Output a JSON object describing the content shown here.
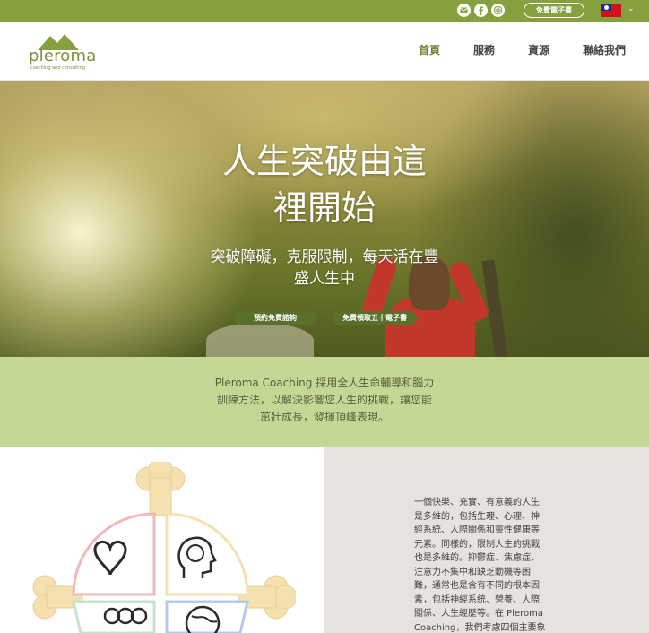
{
  "topbar": {
    "social_icons": [
      "email-icon",
      "facebook-icon",
      "instagram-icon"
    ],
    "ebook_button": "免費電子書",
    "language_flag": "taiwan-flag-icon",
    "bar_color": "#86a040"
  },
  "header": {
    "logo_text": "pleroma",
    "logo_tagline": "coaching and consulting",
    "nav": [
      "首頁",
      "服務",
      "資源",
      "聯絡我們"
    ],
    "active_nav": "首頁",
    "accent": "#6d8234"
  },
  "hero": {
    "title_line1": "人生突破由這",
    "title_line2": "裡開始",
    "subtitle_line1": "突破障礙，克服限制，每天活在豐",
    "subtitle_line2": "盛人生中",
    "buttons": [
      "預約免費諮詢",
      "免費領取五十電子書"
    ]
  },
  "intro": {
    "line1": "Pleroma Coaching 採用全人生命輔導和腦力",
    "line2": "訓練方法，以解決影響您人生的挑戰，讓您能",
    "line3": "茁壯成長，發揮頂峰表現。",
    "background": "#c5d795"
  },
  "body": {
    "lines": [
      "一個快樂、充實、有意義的人生",
      "是多維的，包括生理、心理、神",
      "經系統、人際關係和靈性健康等",
      "元素。同樣的，限制人生的挑戰",
      "也是多維的。抑鬱症、焦慮症、",
      "注意力不集中和缺乏動機等困",
      "難，通常也是含有不同的根本因",
      "素，包括神經系統、營養、人際",
      "關係、人生經歷等。在 Pleroma",
      "Coaching，我們考慮四個主要象"
    ],
    "diagram_icons": [
      "heart-icon",
      "brain-head-icon",
      "people-icon",
      "globe-icon"
    ]
  }
}
